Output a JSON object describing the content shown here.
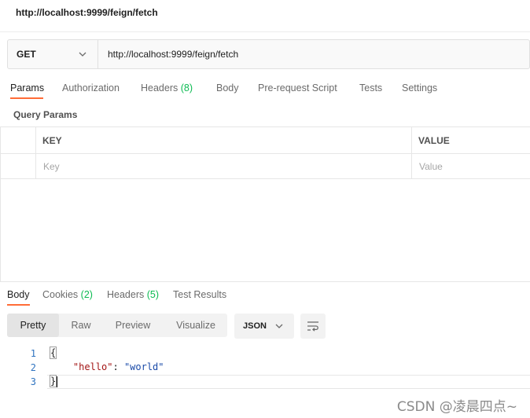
{
  "window": {
    "title": "http://localhost:9999/feign/fetch"
  },
  "request": {
    "method": "GET",
    "url": "http://localhost:9999/feign/fetch"
  },
  "request_tabs": [
    {
      "label": "Params",
      "active": true
    },
    {
      "label": "Authorization"
    },
    {
      "label": "Headers",
      "count": "(8)"
    },
    {
      "label": "Body"
    },
    {
      "label": "Pre-request Script"
    },
    {
      "label": "Tests"
    },
    {
      "label": "Settings"
    }
  ],
  "query_params": {
    "label": "Query Params",
    "columns": [
      "KEY",
      "VALUE"
    ],
    "placeholders": {
      "key": "Key",
      "value": "Value"
    }
  },
  "response_tabs": [
    {
      "label": "Body",
      "active": true
    },
    {
      "label": "Cookies",
      "count": "(2)"
    },
    {
      "label": "Headers",
      "count": "(5)"
    },
    {
      "label": "Test Results"
    }
  ],
  "view_modes": [
    {
      "label": "Pretty",
      "active": true
    },
    {
      "label": "Raw"
    },
    {
      "label": "Preview"
    },
    {
      "label": "Visualize"
    }
  ],
  "format": {
    "label": "JSON"
  },
  "response_body": {
    "line_numbers": [
      "1",
      "2",
      "3"
    ],
    "open_brace": "{",
    "indent": "    ",
    "key": "\"hello\"",
    "colon": ": ",
    "value": "\"world\"",
    "close_brace": "}"
  },
  "watermark": "CSDN @凌晨四点~",
  "colors": {
    "accent": "#ff6c37",
    "count_green": "#0cbb52",
    "line_number_blue": "#2f73c0",
    "json_key": "#a31515",
    "json_string": "#1a4aa8"
  },
  "icons": {
    "method_dropdown": "chevron-down-icon",
    "format_dropdown": "chevron-down-icon",
    "wrap": "wrap-lines-icon"
  }
}
